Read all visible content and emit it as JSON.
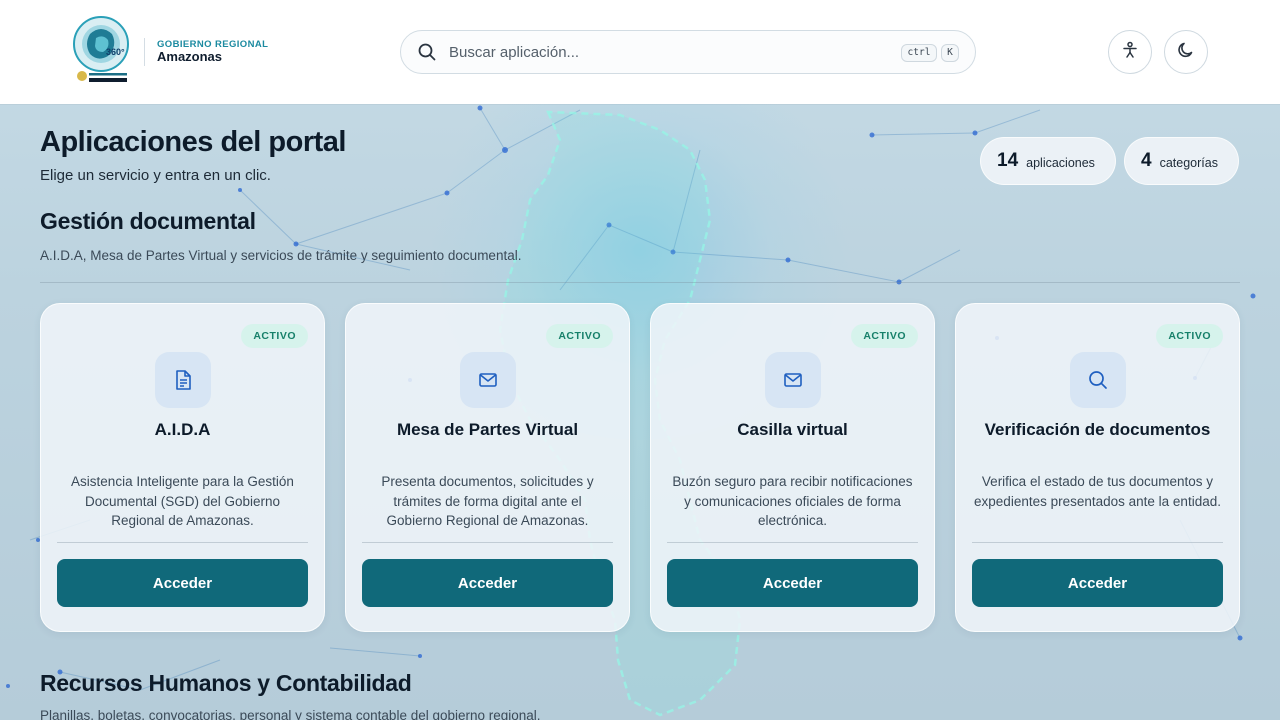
{
  "header": {
    "org_top": "GOBIERNO REGIONAL",
    "org_name": "Amazonas",
    "logo_text": "GOBIERNO REGIONAL AMAZONAS",
    "logo_badge": "360°",
    "search": {
      "placeholder": "Buscar aplicación...",
      "shortcut_ctrl": "ctrl",
      "shortcut_key": "K"
    },
    "buttons": [
      {
        "icon": "accessibility-icon"
      },
      {
        "icon": "moon-icon"
      }
    ]
  },
  "main": {
    "title": "Aplicaciones del portal",
    "subtitle": "Elige un servicio y entra en un clic.",
    "stats": [
      {
        "value": "14",
        "label": "aplicaciones"
      },
      {
        "value": "4",
        "label": "categorías"
      }
    ],
    "sections": [
      {
        "title": "Gestión documental",
        "description": "A.I.D.A, Mesa de Partes Virtual y servicios de trámite y seguimiento documental.",
        "cards": [
          {
            "badge": "ACTIVO",
            "icon": "document-icon",
            "title": "A.I.D.A",
            "description": "Asistencia Inteligente para la Gestión Documental (SGD) del Gobierno Regional de Amazonas.",
            "button": "Acceder"
          },
          {
            "badge": "ACTIVO",
            "icon": "mail-icon",
            "title": "Mesa de Partes Virtual",
            "description": "Presenta documentos, solicitudes y trámites de forma digital ante el Gobierno Regional de Amazonas.",
            "button": "Acceder"
          },
          {
            "badge": "ACTIVO",
            "icon": "mail-icon",
            "title": "Casilla virtual",
            "description": "Buzón seguro para recibir notificaciones y comunicaciones oficiales de forma electrónica.",
            "button": "Acceder"
          },
          {
            "badge": "ACTIVO",
            "icon": "search-icon",
            "title": "Verificación de documentos",
            "description": "Verifica el estado de tus documentos y expedientes presentados ante la entidad.",
            "button": "Acceder"
          }
        ]
      },
      {
        "title": "Recursos Humanos y Contabilidad",
        "description": "Planillas, boletas, convocatorias, personal y sistema contable del gobierno regional."
      }
    ]
  },
  "colors": {
    "accent": "#10697a",
    "badge_bg": "#d6f3ec",
    "badge_text": "#17806a",
    "brand_teal": "#1b8aa0"
  }
}
